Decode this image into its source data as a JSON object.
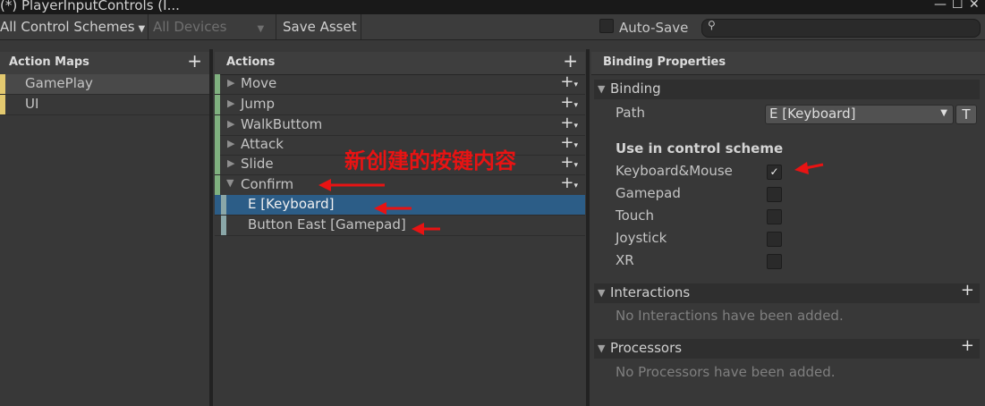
{
  "window": {
    "title": "(*) PlayerInputControls (I...",
    "minimize_glyph": "—",
    "maximize_glyph": "☐",
    "close_glyph": "✕"
  },
  "toolbar": {
    "control_schemes": "All Control Schemes",
    "devices": "All Devices",
    "save_asset": "Save Asset",
    "auto_save": "Auto-Save",
    "search_placeholder": ""
  },
  "action_maps": {
    "header": "Action Maps",
    "items": [
      {
        "label": "GamePlay",
        "selected": true
      },
      {
        "label": "UI",
        "selected": false
      }
    ]
  },
  "actions": {
    "header": "Actions",
    "items": [
      {
        "label": "Move",
        "expanded": false
      },
      {
        "label": "Jump",
        "expanded": false
      },
      {
        "label": "WalkButtom",
        "expanded": false
      },
      {
        "label": "Attack",
        "expanded": false
      },
      {
        "label": "Slide",
        "expanded": false
      },
      {
        "label": "Confirm",
        "expanded": true
      }
    ],
    "bindings": [
      {
        "label": "E [Keyboard]",
        "selected": true
      },
      {
        "label": "Button East [Gamepad]",
        "selected": false
      }
    ]
  },
  "binding_properties": {
    "header": "Binding Properties",
    "binding_section": "Binding",
    "path_label": "Path",
    "path_value": "E [Keyboard]",
    "t_button": "T",
    "control_scheme_heading": "Use in control scheme",
    "schemes": [
      {
        "label": "Keyboard&Mouse",
        "checked": true
      },
      {
        "label": "Gamepad",
        "checked": false
      },
      {
        "label": "Touch",
        "checked": false
      },
      {
        "label": "Joystick",
        "checked": false
      },
      {
        "label": "XR",
        "checked": false
      }
    ],
    "interactions_section": "Interactions",
    "interactions_empty": "No Interactions have been added.",
    "processors_section": "Processors",
    "processors_empty": "No Processors have been added."
  },
  "annotation": {
    "text": "新创建的按键内容"
  },
  "colors": {
    "selected_row": "#2c5d87",
    "map_marker": "#e3c96f",
    "action_marker": "#7fb07f",
    "binding_marker": "#8aa7a8",
    "annotation": "#e81313"
  }
}
